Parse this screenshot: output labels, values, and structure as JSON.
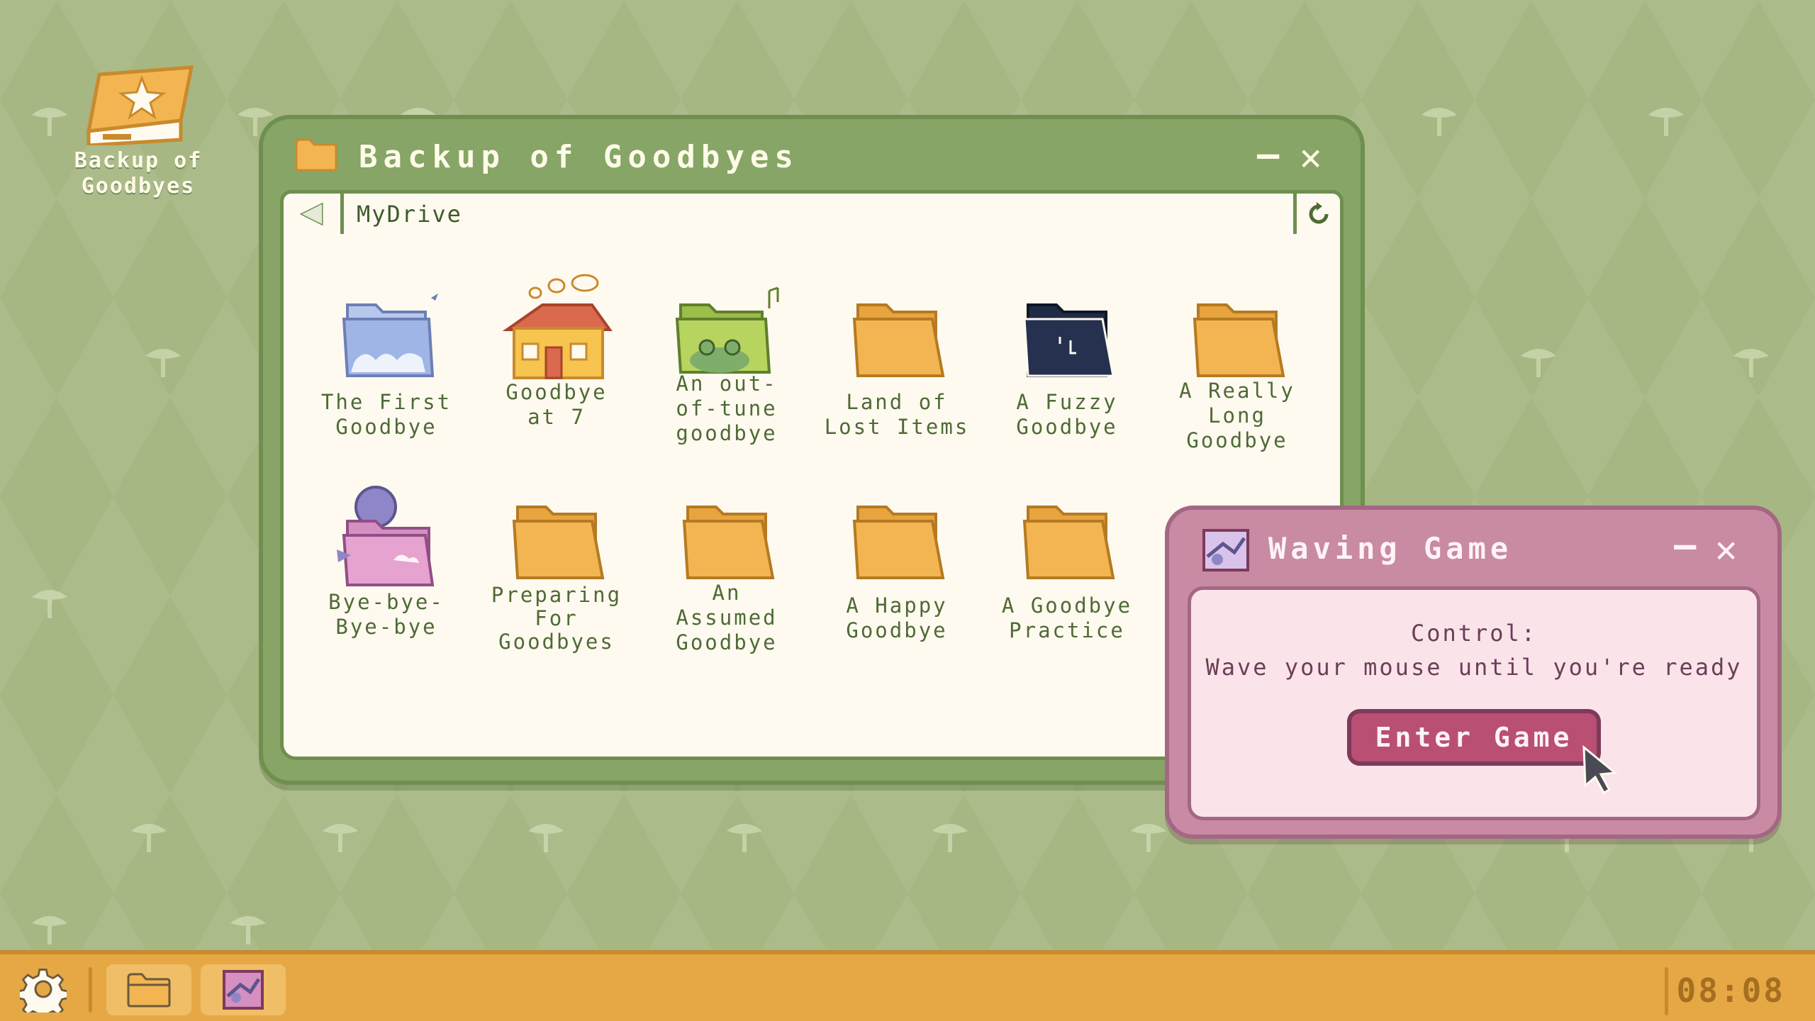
{
  "desktop": {
    "icon_label": "Backup of Goodbyes"
  },
  "explorer": {
    "title": "Backup of Goodbyes",
    "minimize": "–",
    "close": "✕",
    "path": "MyDrive",
    "files": [
      {
        "name": "The First\nGoodbye",
        "icon": "cloud-folder-icon"
      },
      {
        "name": "Goodbye\nat 7",
        "icon": "house-icon"
      },
      {
        "name": "An out-\nof-tune\ngoodbye",
        "icon": "frog-folder-icon"
      },
      {
        "name": "Land of\nLost Items",
        "icon": "folder-icon"
      },
      {
        "name": "A Fuzzy\nGoodbye",
        "icon": "dark-folder-icon"
      },
      {
        "name": "A Really\nLong\nGoodbye",
        "icon": "folder-icon"
      },
      {
        "name": "Bye-bye-\nBye-bye",
        "icon": "pink-folder-icon"
      },
      {
        "name": "Preparing\nFor\nGoodbyes",
        "icon": "folder-icon"
      },
      {
        "name": "An\nAssumed\nGoodbye",
        "icon": "folder-icon"
      },
      {
        "name": "A Happy\nGoodbye",
        "icon": "folder-icon"
      },
      {
        "name": "A Goodbye\nPractice",
        "icon": "folder-icon"
      }
    ]
  },
  "game_window": {
    "title": "Waving Game",
    "minimize": "–",
    "close": "✕",
    "control_label": "Control:",
    "instruction": "Wave your mouse until you're ready",
    "enter_button": "Enter Game"
  },
  "taskbar": {
    "clock": "08:08",
    "items": [
      "settings-gear-icon",
      "folder-icon",
      "waving-game-icon"
    ]
  },
  "colors": {
    "wallpaper": "#a6b783",
    "window_green": "#86a566",
    "window_pink": "#c98aa3",
    "folder_orange": "#f2b552",
    "taskbar": "#e6a845"
  }
}
